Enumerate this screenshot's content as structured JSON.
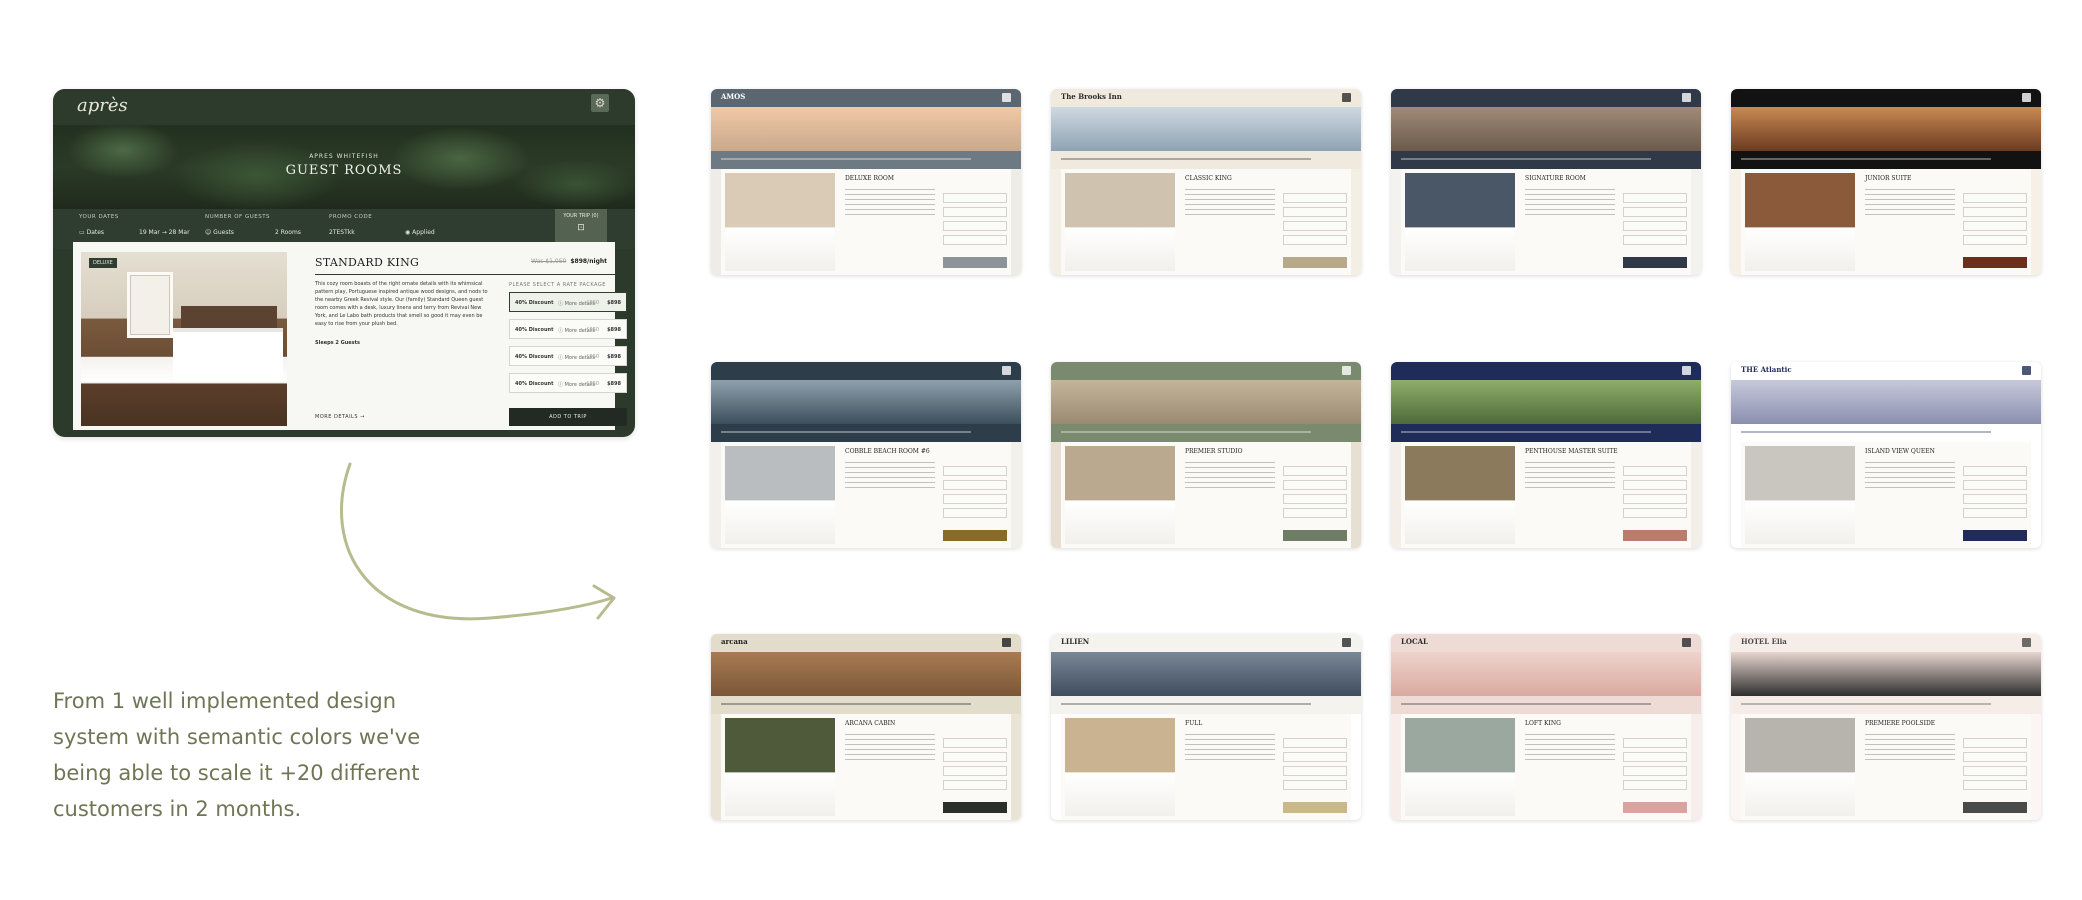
{
  "feature": {
    "logo": "après",
    "gear_icon": "gear-icon",
    "hero_subtitle": "APRES WHITEFISH",
    "hero_title": "GUEST ROOMS",
    "fields": [
      {
        "label": "YOUR DATES",
        "value": "Dates"
      },
      {
        "label": "",
        "value": "19 Mar → 28 Mar"
      },
      {
        "label": "NUMBER OF GUESTS",
        "value": "Guests"
      },
      {
        "label": "",
        "value": "2 Rooms"
      },
      {
        "label": "PROMO CODE",
        "value": "2TESTkk"
      },
      {
        "label": "",
        "value": "Applied"
      }
    ],
    "pay_label": "YOUR TRIP (0)",
    "room": {
      "badge": "DELUXE",
      "name": "STANDARD KING",
      "was_price": "Was $1,050",
      "price": "$898/night",
      "description": "This cozy room boasts of the right ornate details with its whimsical pattern play, Portuguese inspired antique wood designs, and nods to the nearby Greek Revival style. Our (family) Standard Queen guest room comes with a desk, luxury linens and terry from Revival New York, and Le Labo bath products that smell so good it may even be easy to rise from your plush bed.",
      "sleeps": "Sleeps 2 Guests",
      "more": "MORE DETAILS →",
      "rates_heading": "PLEASE SELECT A RATE PACKAGE",
      "rates": [
        {
          "name": "40% Discount",
          "more": "More details",
          "was": "$950",
          "price": "$898"
        },
        {
          "name": "40% Discount",
          "more": "More details",
          "was": "$950",
          "price": "$898"
        },
        {
          "name": "40% Discount",
          "more": "More details",
          "was": "$950",
          "price": "$898"
        },
        {
          "name": "40% Discount",
          "more": "More details",
          "was": "$950",
          "price": "$898"
        }
      ],
      "add_label": "ADD TO TRIP"
    }
  },
  "caption": "From 1 well implemented design system with semantic colors we've being able to scale it +20 different customers in 2 months.",
  "thumbnails": [
    {
      "logo": "AMOS",
      "room": "DELUXE ROOM",
      "top": "#5b6770",
      "hero": "#c9a88c",
      "hero2": "#f0c9a6",
      "bar": "#6e7a83",
      "panelbg": "#eeece6",
      "add": "#8d9499",
      "img": "#d9cbb5",
      "logo_color": "#ffffff"
    },
    {
      "logo": "The Brooks Inn",
      "room": "CLASSIC KING",
      "top": "#efeadd",
      "hero": "#8ea3b3",
      "hero2": "#cfd9e1",
      "bar": "#efeadd",
      "panelbg": "#f3efe4",
      "add": "#b8a98a",
      "img": "#cfc3af",
      "logo_color": "#2b2b2b"
    },
    {
      "logo": "",
      "room": "SIGNATURE ROOM",
      "top": "#2f3947",
      "hero": "#6b5a4c",
      "hero2": "#a18b77",
      "bar": "#2f3947",
      "panelbg": "#f4f2ee",
      "add": "#2f3947",
      "img": "#4a5766",
      "logo_color": "#ffffff"
    },
    {
      "logo": "",
      "room": "JUNIOR SUITE",
      "top": "#121212",
      "hero": "#6b3b22",
      "hero2": "#c98a52",
      "bar": "#121212",
      "panelbg": "#f6f0e6",
      "add": "#6b2f1d",
      "img": "#8a5a3a",
      "logo_color": "#ffffff"
    },
    {
      "logo": "",
      "room": "COBBLE BEACH ROOM #6",
      "top": "#2e3d4a",
      "hero": "#3c4f5c",
      "hero2": "#8fa1ad",
      "bar": "#2e3d4a",
      "panelbg": "#f2f0ea",
      "add": "#8a6a2b",
      "img": "#b9bdbf",
      "logo_color": "#ffffff"
    },
    {
      "logo": "",
      "room": "PREMIER STUDIO",
      "top": "#7a8a6e",
      "hero": "#9a8a72",
      "hero2": "#c4b59a",
      "bar": "#7a8a6e",
      "panelbg": "#e7e0d2",
      "add": "#6e7d64",
      "img": "#bba98f",
      "logo_color": "#ffffff"
    },
    {
      "logo": "",
      "room": "PENTHOUSE MASTER SUITE",
      "top": "#1f2c5a",
      "hero": "#4f6a3a",
      "hero2": "#8fae6a",
      "bar": "#1f2c5a",
      "panelbg": "#f3efe8",
      "add": "#b97d6c",
      "img": "#8c7a5c",
      "logo_color": "#ffffff"
    },
    {
      "logo": "THE Atlantic",
      "room": "ISLAND VIEW QUEEN",
      "top": "#ffffff",
      "hero": "#8b8fb0",
      "hero2": "#c7c9da",
      "bar": "#ffffff",
      "panelbg": "#ffffff",
      "add": "#1f2c5a",
      "img": "#c9c6c0",
      "logo_color": "#1f2c5a"
    },
    {
      "logo": "arcana",
      "room": "ARCANA CABIN",
      "top": "#e2dccb",
      "hero": "#7a5638",
      "hero2": "#a87c52",
      "bar": "#e2dccb",
      "panelbg": "#e9e4d6",
      "add": "#2a2f2a",
      "img": "#4f5a3a",
      "logo_color": "#1f1f1f"
    },
    {
      "logo": "LILIEN",
      "room": "FULL",
      "top": "#f5f3ee",
      "hero": "#3f4d5e",
      "hero2": "#7a8797",
      "bar": "#f5f3ee",
      "panelbg": "#ffffff",
      "add": "#c9b98a",
      "img": "#c9b391",
      "logo_color": "#2b2b2b"
    },
    {
      "logo": "LOCAL",
      "room": "LOFT KING",
      "top": "#efdbd6",
      "hero": "#d9a9a0",
      "hero2": "#efd3cc",
      "bar": "#efdbd6",
      "panelbg": "#f7eeeb",
      "add": "#d9a3a0",
      "img": "#9aa8a0",
      "logo_color": "#2b2b2b"
    },
    {
      "logo": "HOTEL Ella",
      "room": "PREMIERE POOLSIDE",
      "top": "#f6ede9",
      "hero": "#2f2f2f",
      "hero2": "#e8d6cf",
      "bar": "#f6ede9",
      "panelbg": "#fbf6f3",
      "add": "#4a4a4a",
      "img": "#b7b3ad",
      "logo_color": "#4a4a4a"
    }
  ],
  "colors": {
    "caption": "#6f7656",
    "arrow": "#b7bb8e",
    "feature_dark": "#2f3d30"
  }
}
